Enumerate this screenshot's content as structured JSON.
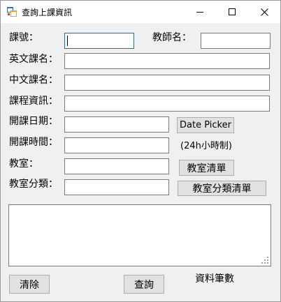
{
  "window": {
    "title": "查詢上課資訊",
    "app_icon": "form-icon",
    "controls": {
      "minimize": "minimize-icon",
      "maximize": "maximize-icon",
      "close": "close-icon"
    }
  },
  "form": {
    "course_id_label": "課號：",
    "course_id_value": "",
    "teacher_label": "教師名：",
    "teacher_value": "",
    "english_name_label": "英文課名：",
    "english_name_value": "",
    "chinese_name_label": "中文課名：",
    "chinese_name_value": "",
    "course_info_label": "課程資訊：",
    "course_info_value": "",
    "start_date_label": "開課日期：",
    "start_date_value": "",
    "date_picker_label": "Date Picker",
    "start_time_label": "開課時間：",
    "start_time_value": "",
    "time_hint": "(24h小時制)",
    "classroom_label": "教室：",
    "classroom_value": "",
    "classroom_list_label": "教室清單",
    "classroom_type_label": "教室分類：",
    "classroom_type_value": "",
    "classroom_type_list_label": "教室分類清單"
  },
  "results": {
    "text": ""
  },
  "footer": {
    "clear_label": "清除",
    "query_label": "查詢",
    "count_label": "資料筆數"
  }
}
